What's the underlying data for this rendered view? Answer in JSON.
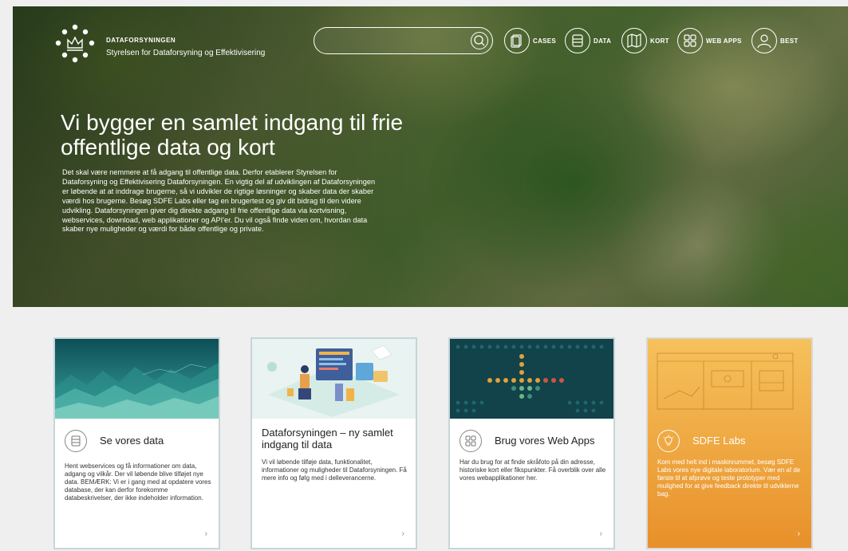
{
  "brand": {
    "name": "DATAFORSYNINGEN",
    "subtitle": "Styrelsen for Dataforsyning og Effektivisering"
  },
  "search": {
    "placeholder": ""
  },
  "nav": [
    {
      "label": "CASES",
      "icon": "cases-icon"
    },
    {
      "label": "DATA",
      "icon": "data-icon"
    },
    {
      "label": "KORT",
      "icon": "map-icon"
    },
    {
      "label": "WEB APPS",
      "icon": "apps-icon"
    },
    {
      "label": "BEST",
      "icon": "user-icon"
    }
  ],
  "hero": {
    "title": "Vi bygger en samlet indgang til frie offentlige data og kort",
    "text": "Det skal være nemmere at få adgang til offentlige data. Derfor etablerer Styrelsen for Dataforsyning og Effektivisering Dataforsyningen. En vigtig del af udviklingen af Dataforsyningen er løbende at at inddrage brugerne, så vi udvikler de rigtige løsninger og skaber data der skaber værdi hos brugerne. Besøg SDFE Labs eller tag en brugertest og giv dit bidrag til den videre udvikling. Dataforsyningen giver dig direkte adgang til frie offentlige data via kortvisning, webservices, download, web applikationer og API'er. Du vil også finde viden om, hvordan data skaber nye muligheder og værdi for både offentlige og private."
  },
  "cards": [
    {
      "title": "Se vores data",
      "text": "Hent webservices og få informationer om data, adgang og vilkår. Der vil løbende blive tilføjet nye data. BEMÆRK: Vi er i gang med at opdatere vores database, der kan derfor forekomme databeskrivelser, der ikke indeholder information.",
      "chevron": "›"
    },
    {
      "title": "Dataforsyningen – ny samlet indgang til data",
      "text": "Vi vil løbende tilføje data, funktionalitet, informationer og muligheder til Dataforsyningen. Få mere info og følg med i delleverancerne.",
      "chevron": "›"
    },
    {
      "title": "Brug vores Web Apps",
      "text": "Har du brug for at finde skråfoto på din adresse, historiske kort eller fikspunkter. Få overblik over alle vores webapplikationer her.",
      "chevron": "›"
    },
    {
      "title": "SDFE Labs",
      "text": "Kom med helt ind i maskinrummet, besøg SDFE Labs vores nye digitale laboratorium. Vær en af de første til at afprøve og teste prototyper med mulighed for at give feedback direkte til udviklerne bag.",
      "chevron": "›"
    }
  ],
  "colors": {
    "card_border": "#c5d6d9",
    "labs_orange_top": "#f6c15b",
    "labs_orange_bottom": "#e8902a"
  }
}
